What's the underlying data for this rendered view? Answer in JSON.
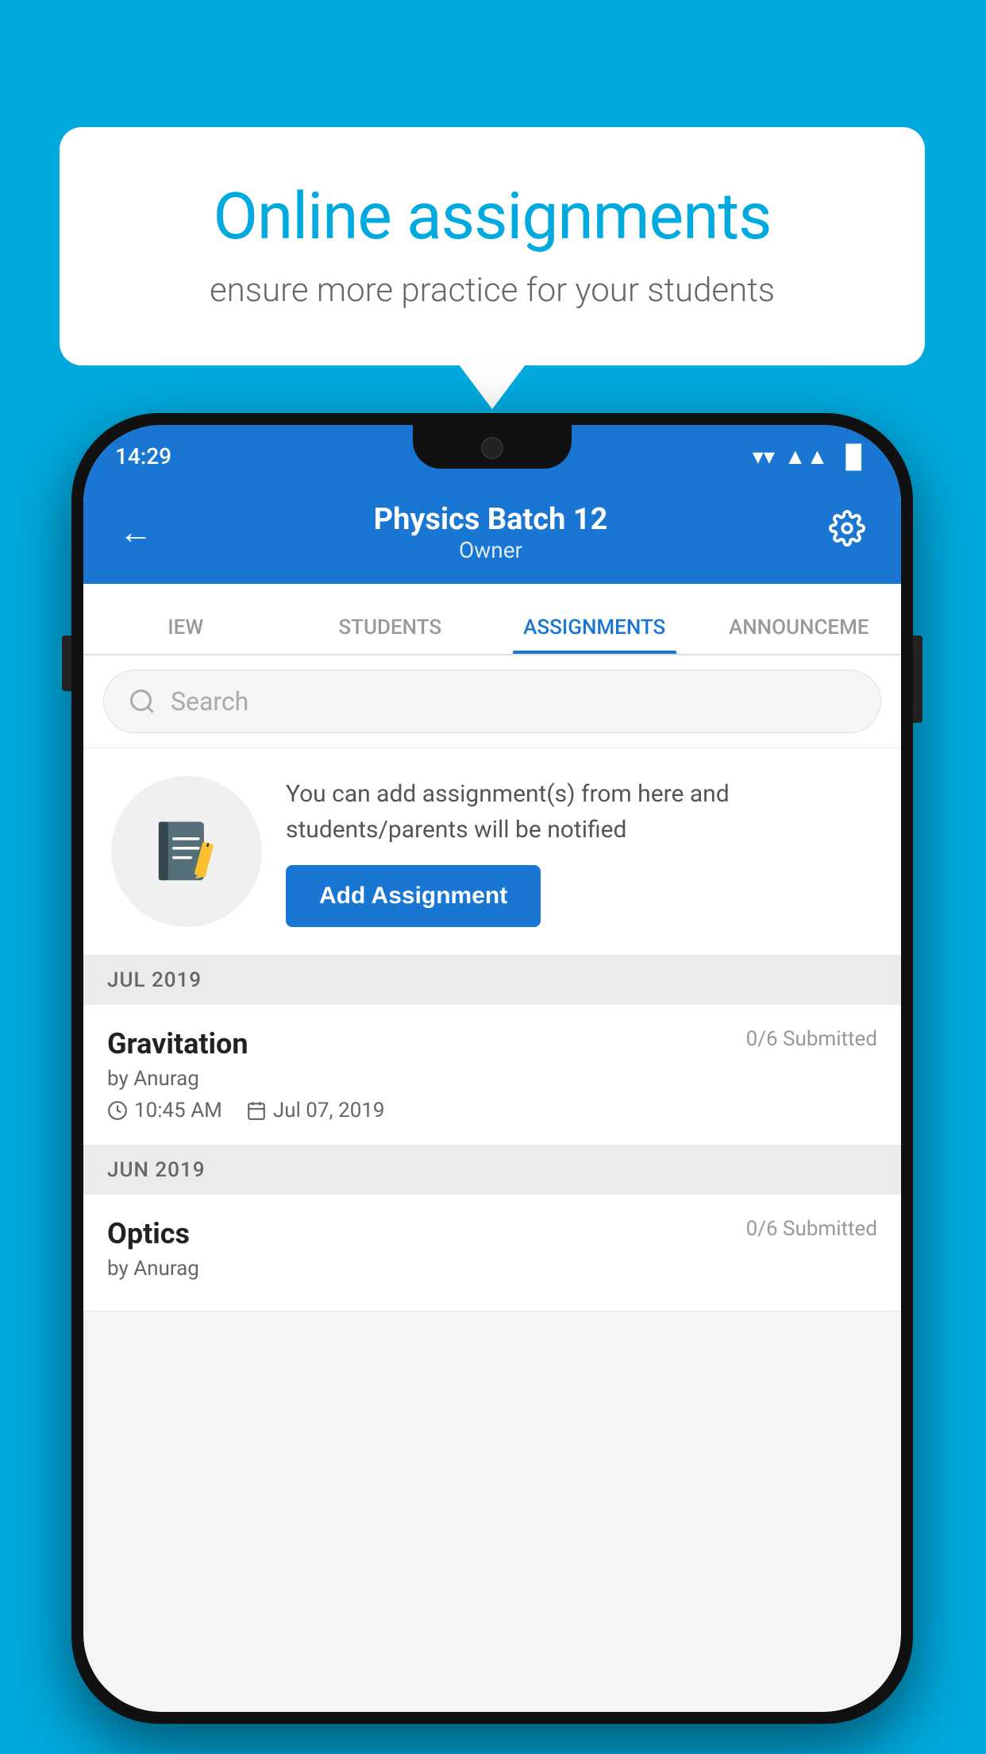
{
  "background_color": "#00AADF",
  "bubble": {
    "title": "Online assignments",
    "subtitle": "ensure more practice for your students"
  },
  "status_bar": {
    "time": "14:29",
    "wifi": "▼",
    "signal": "▲",
    "battery": "▐"
  },
  "app_bar": {
    "title": "Physics Batch 12",
    "subtitle": "Owner",
    "back_label": "←",
    "settings_label": "⚙"
  },
  "tabs": [
    {
      "label": "IEW",
      "active": false
    },
    {
      "label": "STUDENTS",
      "active": false
    },
    {
      "label": "ASSIGNMENTS",
      "active": true
    },
    {
      "label": "ANNOUNCEMENTS",
      "active": false
    }
  ],
  "search": {
    "placeholder": "Search"
  },
  "add_assignment": {
    "description": "You can add assignment(s) from here and students/parents will be notified",
    "button_label": "Add Assignment"
  },
  "months": [
    {
      "label": "JUL 2019",
      "assignments": [
        {
          "name": "Gravitation",
          "submitted": "0/6 Submitted",
          "by": "by Anurag",
          "time": "10:45 AM",
          "date": "Jul 07, 2019"
        }
      ]
    },
    {
      "label": "JUN 2019",
      "assignments": [
        {
          "name": "Optics",
          "submitted": "0/6 Submitted",
          "by": "by Anurag",
          "time": "",
          "date": ""
        }
      ]
    }
  ]
}
